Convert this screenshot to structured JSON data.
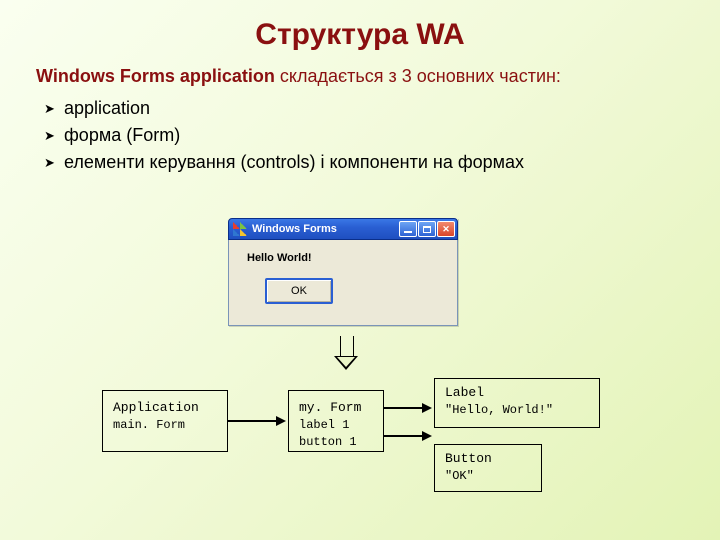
{
  "title": "Структура WA",
  "intro": {
    "strong": "Windows Forms application",
    "rest": " складається з 3 основних частин:"
  },
  "bullets": [
    "application",
    "форма (Form)",
    "елементи керування (controls) і компоненти на формах"
  ],
  "window": {
    "title": "Windows Forms",
    "label": "Hello World!",
    "ok": "OK"
  },
  "diagram": {
    "app": {
      "head": "Application",
      "sub": "main. Form"
    },
    "form": {
      "head": "my. Form",
      "sub1": "label 1",
      "sub2": "button 1"
    },
    "label": {
      "head": "Label",
      "sub": "\"Hello, World!\""
    },
    "button": {
      "head": "Button",
      "sub": "\"OK\""
    }
  }
}
